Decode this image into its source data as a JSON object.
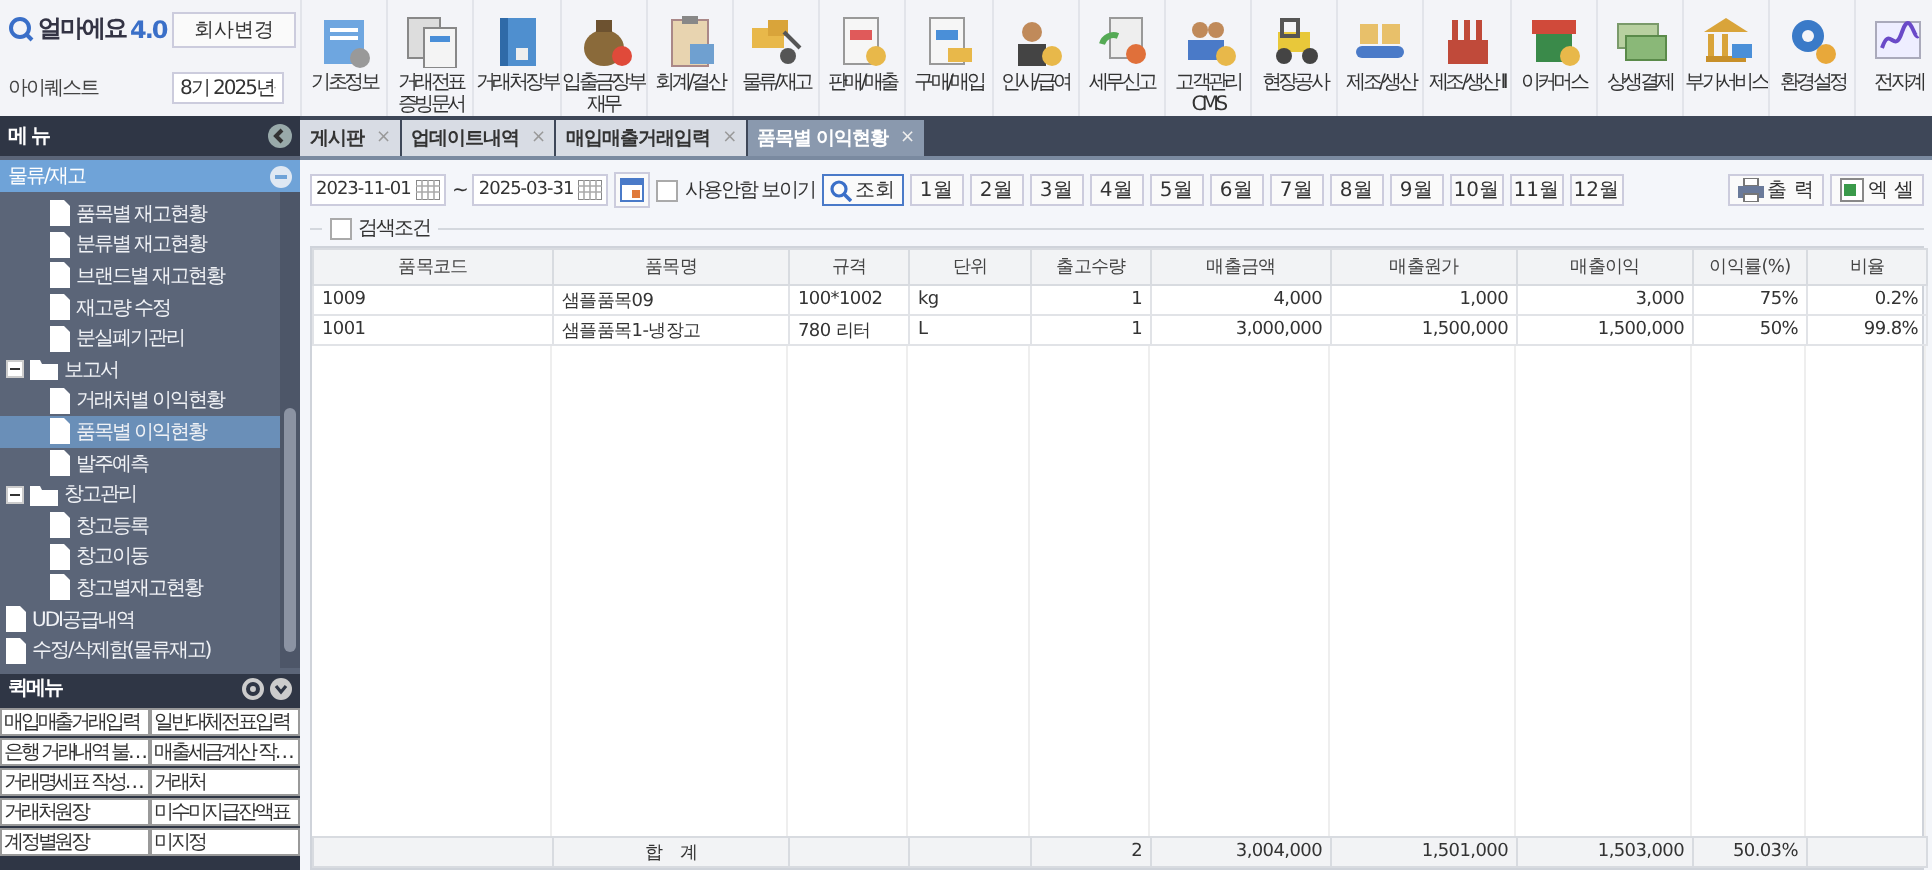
{
  "header": {
    "logo": "얼마에요",
    "version": "4.0",
    "company_button": "회사변경",
    "company": "아이퀘스트",
    "period": "8기 2025년"
  },
  "toolbar": [
    {
      "label": "기초정보"
    },
    {
      "label": "거래전표\n증빙문서"
    },
    {
      "label": "거래처장부"
    },
    {
      "label": "입출금장부\n재무"
    },
    {
      "label": "회계/결산"
    },
    {
      "label": "물류/재고"
    },
    {
      "label": "판매/매출"
    },
    {
      "label": "구매/매입"
    },
    {
      "label": "인사/급여"
    },
    {
      "label": "세무신고"
    },
    {
      "label": "고객관리\nCMS"
    },
    {
      "label": "현장공사"
    },
    {
      "label": "제조/생산"
    },
    {
      "label": "제조/생산 II"
    },
    {
      "label": "이커머스"
    },
    {
      "label": "상생결제"
    },
    {
      "label": "부가서비스"
    },
    {
      "label": "환경설정"
    },
    {
      "label": "전자계"
    }
  ],
  "sidebar": {
    "title": "메 뉴",
    "section": "물류/재고",
    "tree": [
      {
        "kind": "group",
        "children": [
          {
            "kind": "doc",
            "label": "품목별 재고현황",
            "selected": false
          },
          {
            "kind": "doc",
            "label": "분류별 재고현황",
            "selected": false
          },
          {
            "kind": "doc",
            "label": "브랜드별 재고현황",
            "selected": false
          },
          {
            "kind": "doc",
            "label": "재고량 수정",
            "selected": false
          },
          {
            "kind": "doc",
            "label": "분실폐기관리",
            "selected": false
          }
        ]
      },
      {
        "kind": "folder",
        "label": "보고서",
        "expanded": true,
        "selected": false,
        "children": [
          {
            "kind": "doc",
            "label": "거래처별 이익현황",
            "selected": false
          },
          {
            "kind": "doc",
            "label": "품목별 이익현황",
            "selected": true
          },
          {
            "kind": "doc",
            "label": "발주예측",
            "selected": false
          }
        ]
      },
      {
        "kind": "folder",
        "label": "창고관리",
        "expanded": true,
        "selected": false,
        "children": [
          {
            "kind": "doc",
            "label": "창고등록",
            "selected": false
          },
          {
            "kind": "doc",
            "label": "창고이동",
            "selected": false
          },
          {
            "kind": "doc",
            "label": "창고별재고현황",
            "selected": false
          }
        ]
      },
      {
        "kind": "doc",
        "label": "UDI공급내역",
        "selected": false
      },
      {
        "kind": "doc",
        "label": "수정/삭제함(물류재고)",
        "selected": false
      }
    ],
    "quick_title": "퀵메뉴",
    "quick_menu": [
      "매입매출거래입력",
      "일반대체전표입력",
      "은행 거래내역 불…",
      "매출세금계산 작…",
      "거래명세표 작성…",
      "거래처",
      "거래처원장",
      "미수미지급잔액표",
      "계정별원장",
      "미지정"
    ]
  },
  "tabs": [
    {
      "label": "게시판",
      "selected": false
    },
    {
      "label": "업데이트내역",
      "selected": false
    },
    {
      "label": "매입매출거래입력",
      "selected": false
    },
    {
      "label": "품목별 이익현황",
      "selected": true
    }
  ],
  "close_glyph": "×",
  "filter": {
    "date_from": "2023-11-01",
    "separator": "~",
    "date_to": "2025-03-31",
    "show_unused": {
      "label": "사용안함 보이기",
      "checked": false
    },
    "search_button": "조회",
    "months": [
      "1월",
      "2월",
      "3월",
      "4월",
      "5월",
      "6월",
      "7월",
      "8월",
      "9월",
      "10월",
      "11월",
      "12월"
    ],
    "print_button": "출 력",
    "excel_button": "엑 셀",
    "conditions": {
      "label": "검색조건",
      "checked": false
    }
  },
  "table": {
    "columns": [
      {
        "label": "품목코드",
        "kind": "text"
      },
      {
        "label": "품목명",
        "kind": "text"
      },
      {
        "label": "규격",
        "kind": "text"
      },
      {
        "label": "단위",
        "kind": "text"
      },
      {
        "label": "출고수량",
        "kind": "number"
      },
      {
        "label": "매출금액",
        "kind": "number"
      },
      {
        "label": "매출원가",
        "kind": "number"
      },
      {
        "label": "매출이익",
        "kind": "number"
      },
      {
        "label": "이익률(%)",
        "kind": "number"
      },
      {
        "label": "비율",
        "kind": "number"
      }
    ],
    "rows": [
      [
        "1009",
        "샘플품목09",
        "100*1002",
        "kg",
        "1",
        "4,000",
        "1,000",
        "3,000",
        "75%",
        "0.2%"
      ],
      [
        "1001",
        "샘플품목1-냉장고",
        "780 리터",
        "L",
        "1",
        "3,000,000",
        "1,500,000",
        "1,500,000",
        "50%",
        "99.8%"
      ]
    ],
    "total": {
      "label": "합　계",
      "values": [
        "2",
        "3,004,000",
        "1,501,000",
        "1,503,000",
        "50.03%"
      ]
    }
  }
}
